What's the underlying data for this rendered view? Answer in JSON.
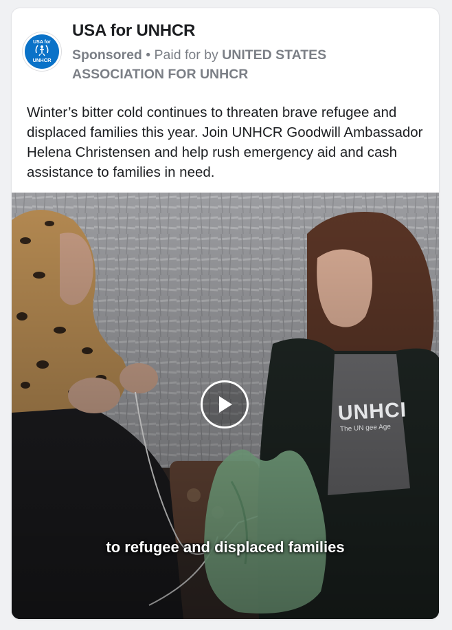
{
  "post": {
    "advertiser": "USA for UNHCR",
    "avatar_text_top": "USA for",
    "avatar_text_bottom": "UNHCR",
    "sponsored": "Sponsored",
    "separator": " • ",
    "paid_for_prefix": "Paid for by ",
    "paid_for_org": "UNITED STATES ASSOCIATION FOR UNHCR",
    "body": "Winter’s bitter cold continues to threaten brave refugee and displaced families this year. Join UNHCR Goodwill Ambassador Helena Christensen and help rush emergency aid and cash assistance to families in need."
  },
  "video": {
    "caption": "to refugee and displaced families",
    "shirt_logo": "UNHCI",
    "shirt_sub": "The UN     gee Age",
    "play_icon": "play-icon"
  },
  "colors": {
    "brand_blue": "#0a72c8",
    "meta_gray": "#7b7f86",
    "text": "#1c1e21",
    "card_bg": "#ffffff"
  }
}
